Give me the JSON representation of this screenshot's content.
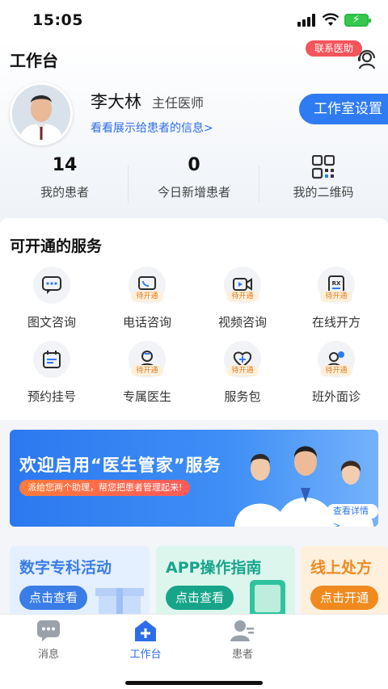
{
  "status_bar": {
    "time": "15:05"
  },
  "header": {
    "title": "工作台",
    "contact_label": "联系医助"
  },
  "doctor": {
    "name": "李大林",
    "title": "主任医师",
    "info_link": "看看展示给患者的信息>",
    "studio_button": "工作室设置"
  },
  "stats": [
    {
      "value": "14",
      "label": "我的患者"
    },
    {
      "value": "0",
      "label": "今日新增患者"
    },
    {
      "label": "我的二维码"
    }
  ],
  "services": {
    "title": "可开通的服务",
    "pending_tag": "待开通",
    "items": [
      {
        "label": "图文咨询",
        "pending": false,
        "icon": "chat-icon"
      },
      {
        "label": "电话咨询",
        "pending": true,
        "icon": "phone-chat-icon"
      },
      {
        "label": "视频咨询",
        "pending": true,
        "icon": "video-icon"
      },
      {
        "label": "在线开方",
        "pending": true,
        "icon": "prescription-icon"
      },
      {
        "label": "预约挂号",
        "pending": false,
        "icon": "calendar-icon"
      },
      {
        "label": "专属医生",
        "pending": true,
        "icon": "doctor-icon"
      },
      {
        "label": "服务包",
        "pending": true,
        "icon": "heart-plus-icon"
      },
      {
        "label": "班外面诊",
        "pending": true,
        "icon": "people-icon"
      }
    ]
  },
  "banner": {
    "title": "欢迎启用“医生管家”服务",
    "subtitle": "派给您两个助理，帮您把患者管理起来!",
    "detail_button": "查看详情 >"
  },
  "cards": [
    {
      "title": "数字专科活动",
      "button": "点击查看",
      "color": "#3a7de6",
      "bg": "#e4efff"
    },
    {
      "title": "APP操作指南",
      "button": "点击查看",
      "color": "#17a58a",
      "bg": "#dcf6ee"
    },
    {
      "title": "线上处方",
      "button": "点击开通",
      "color": "#f08a1f",
      "bg": "#fff0dd"
    }
  ],
  "tabbar": [
    {
      "label": "消息",
      "icon": "message-icon"
    },
    {
      "label": "工作台",
      "icon": "workbench-icon",
      "active": true
    },
    {
      "label": "患者",
      "icon": "patient-icon"
    }
  ],
  "colors": {
    "primary": "#2f7bf2",
    "red": "#f5545b",
    "pending": "#e07a1f"
  }
}
